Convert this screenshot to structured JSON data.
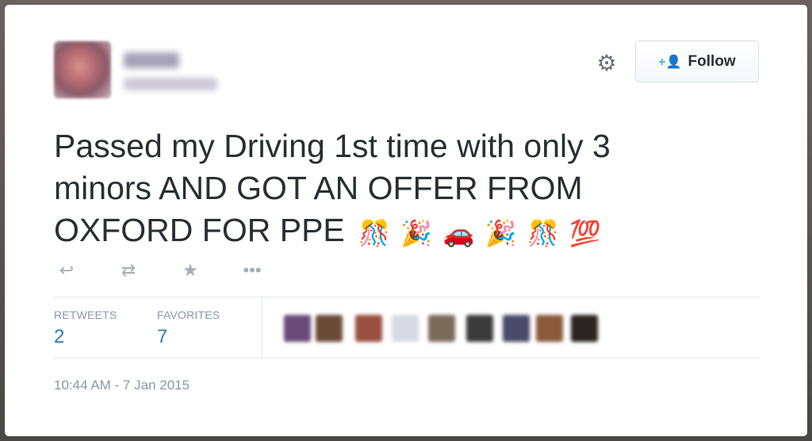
{
  "tweet": {
    "text_lines": [
      "Passed my Driving 1st time with only 3",
      "minors AND GOT AN OFFER FROM",
      "OXFORD FOR PPE"
    ],
    "emojis": [
      "🎊",
      "🎉",
      "🚗",
      "🎉",
      "🎊",
      "💯"
    ]
  },
  "header": {
    "follow_label": "Follow",
    "follow_icon": "+👤",
    "gear_icon": "⚙"
  },
  "actions": {
    "reply_icon": "↩",
    "retweet_icon": "⇄",
    "favorite_icon": "★",
    "more_icon": "•••"
  },
  "stats": {
    "retweets_label": "RETWEETS",
    "retweets_value": "2",
    "favorites_label": "FAVORITES",
    "favorites_value": "7"
  },
  "timestamp": "10:44 AM - 7 Jan 2015",
  "colors": {
    "accent": "#2b7bb9",
    "follow_icon": "#55acee",
    "muted": "#8899a6"
  }
}
